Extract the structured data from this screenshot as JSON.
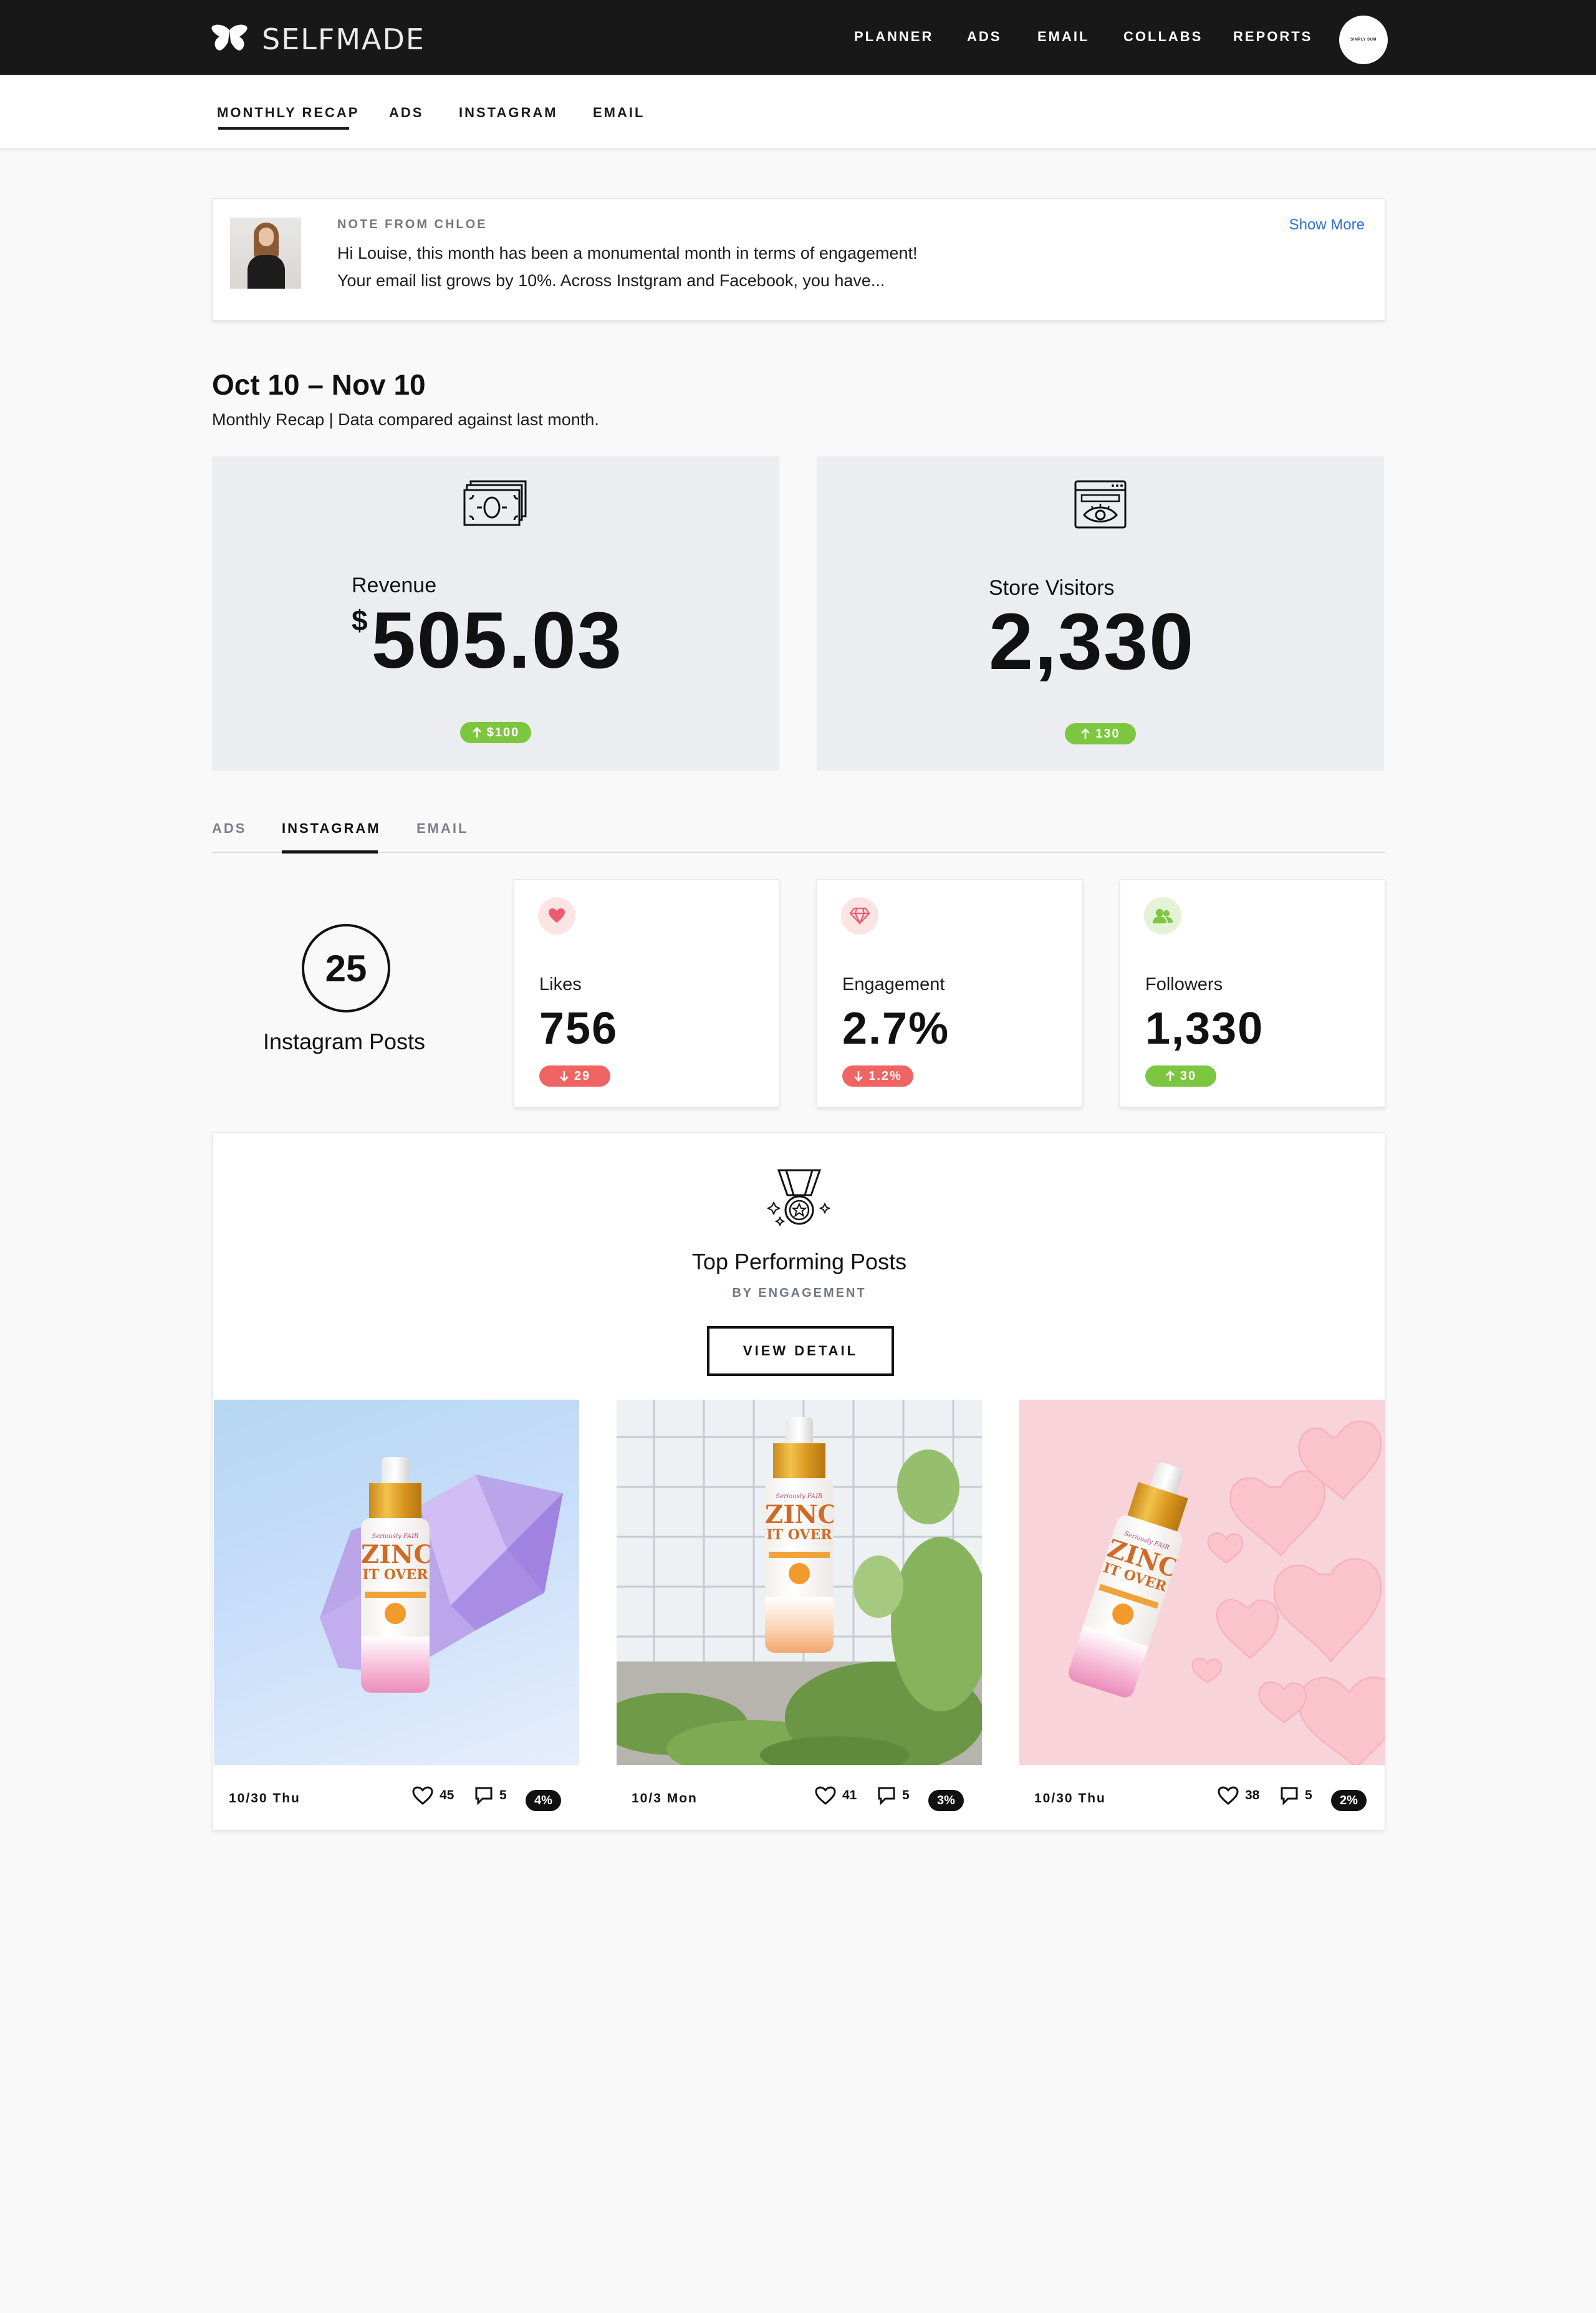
{
  "header": {
    "logo_text": "SELFMADE",
    "nav": [
      "PLANNER",
      "ADS",
      "EMAIL",
      "COLLABS",
      "REPORTS"
    ],
    "account_label": "SIMPLY SUM"
  },
  "subnav": {
    "items": [
      "MONTHLY RECAP",
      "ADS",
      "INSTAGRAM",
      "EMAIL"
    ],
    "active": "MONTHLY RECAP"
  },
  "note": {
    "label": "NOTE FROM CHLOE",
    "line1": "Hi Louise, this month has been a monumental month in terms of engagement!",
    "line2": "Your email list grows by 10%. Across Instgram and Facebook, you have...",
    "show_more": "Show More"
  },
  "period": {
    "title": "Oct 10 – Nov 10",
    "subtitle": "Monthly Recap | Data compared against last month."
  },
  "revenue": {
    "label": "Revenue",
    "currency": "$",
    "value": "505.03",
    "change": "$100",
    "direction": "up"
  },
  "visitors": {
    "label": "Store Visitors",
    "value": "2,330",
    "change": "130",
    "direction": "up"
  },
  "channel_tabs": {
    "items": [
      "ADS",
      "INSTAGRAM",
      "EMAIL"
    ],
    "active": "INSTAGRAM"
  },
  "instagram": {
    "posts_count": "25",
    "posts_label": "Instagram Posts",
    "stats": [
      {
        "label": "Likes",
        "value": "756",
        "change": "29",
        "direction": "down",
        "icon": "heart-icon",
        "color": "#f06464"
      },
      {
        "label": "Engagement",
        "value": "2.7%",
        "change": "1.2%",
        "direction": "down",
        "icon": "diamond-icon",
        "color": "#f06464"
      },
      {
        "label": "Followers",
        "value": "1,330",
        "change": "30",
        "direction": "up",
        "icon": "followers-icon",
        "color": "#7dc63f"
      }
    ]
  },
  "top_posts": {
    "title": "Top Performing Posts",
    "subtitle": "BY ENGAGEMENT",
    "button": "VIEW DETAIL",
    "posts": [
      {
        "date": "10/30 Thu",
        "likes": "45",
        "comments": "5",
        "rate": "4%",
        "theme": "blue-crystal"
      },
      {
        "date": "10/3 Mon",
        "likes": "41",
        "comments": "5",
        "rate": "3%",
        "theme": "tile-plants"
      },
      {
        "date": "10/30 Thu",
        "likes": "38",
        "comments": "5",
        "rate": "2%",
        "theme": "pink-hearts"
      }
    ],
    "product": {
      "brand": "Seriously FAIR",
      "name_line1": "ZINC",
      "name_line2": "IT OVER"
    }
  },
  "colors": {
    "topbar": "#181818",
    "up": "#7dc63f",
    "down": "#f06464",
    "link": "#2f6fd6"
  }
}
